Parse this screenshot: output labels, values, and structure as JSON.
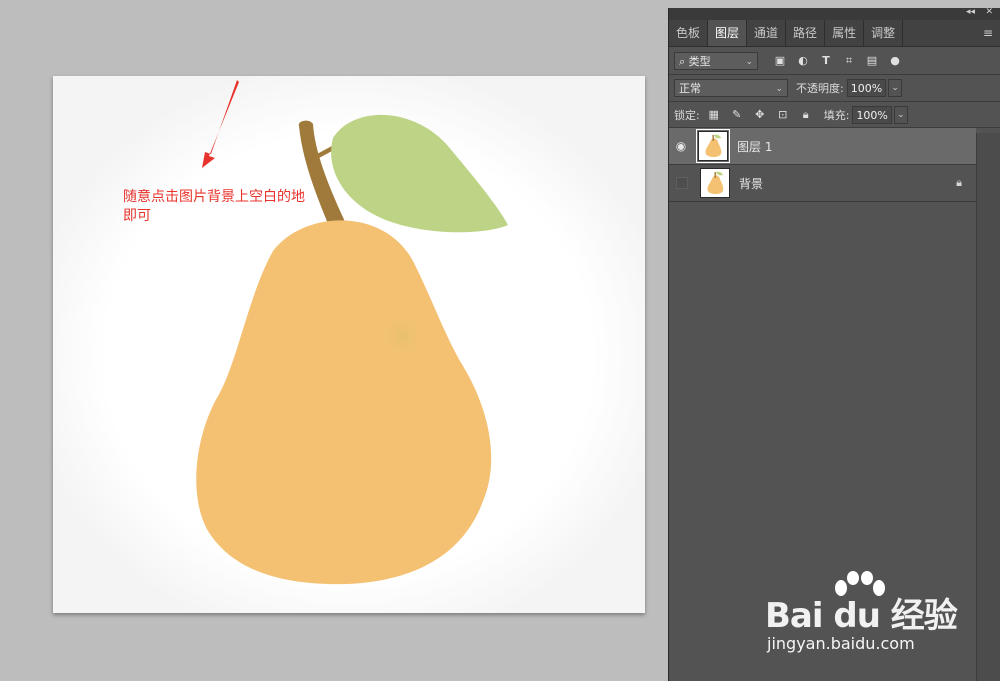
{
  "canvas": {
    "annotation": "随意点击图片背景上空白的地即可",
    "colors": {
      "pear": "#f4c173",
      "leaf": "#bdd385",
      "stem": "#a07a3a",
      "arrow": "#e8332c"
    }
  },
  "panel": {
    "tabs": [
      "色板",
      "图层",
      "通道",
      "路径",
      "属性",
      "调整"
    ],
    "active_tab": "图层",
    "filter": {
      "value": "类型"
    },
    "blend_mode": "正常",
    "opacity_label": "不透明度:",
    "opacity_value": "100%",
    "lock_label": "锁定:",
    "fill_label": "填充:",
    "fill_value": "100%",
    "layers": [
      {
        "name": "图层 1",
        "visible": true,
        "selected": true
      },
      {
        "name": "背景",
        "visible": false,
        "locked": true
      }
    ]
  },
  "watermark": {
    "brand": "Bai du 经验",
    "url": "jingyan.baidu.com"
  }
}
